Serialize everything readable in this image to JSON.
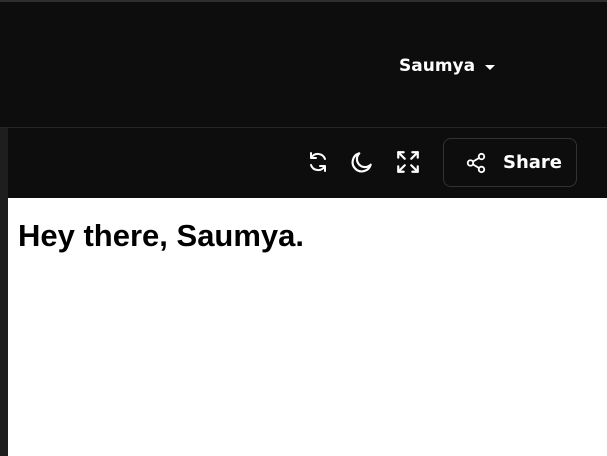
{
  "header": {
    "user_name": "Saumya",
    "user_menu_icon": "chevron-down-icon"
  },
  "toolbar": {
    "icons": [
      "refresh-icon",
      "moon-icon",
      "fullscreen-icon"
    ],
    "share_label": "Share",
    "share_icon": "share-icon"
  },
  "content": {
    "greeting": "Hey there, Saumya."
  },
  "colors": {
    "background": "#0d0d0d",
    "content_background": "#ffffff",
    "text_light": "#ffffff",
    "text_dark": "#000000",
    "border": "#333333"
  }
}
